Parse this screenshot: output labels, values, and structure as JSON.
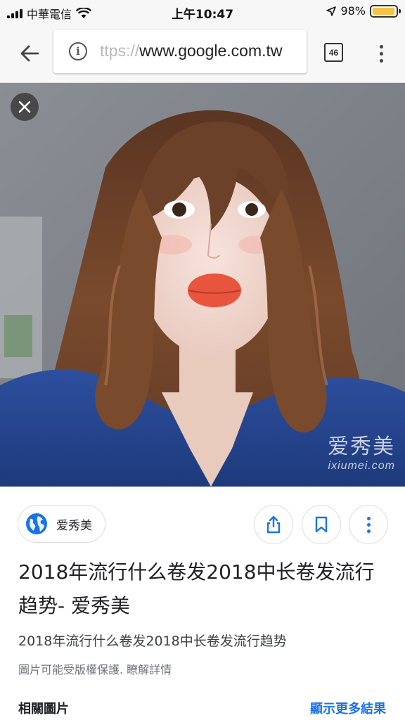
{
  "status_bar": {
    "carrier": "中華電信",
    "time": "上午10:47",
    "battery": "98%",
    "battery_level": 0.98
  },
  "browser": {
    "back_icon": "arrow-left-icon",
    "info_icon": "info-icon",
    "url_faded": "ttps://",
    "url_main": "www.google.com.tw",
    "tab_count": "46",
    "menu_icon": "more-vert-icon"
  },
  "image_viewer": {
    "close_icon": "close-icon",
    "watermark_title": "爱秀美",
    "watermark_domain": "ixiumei.com"
  },
  "result": {
    "source": "爱秀美",
    "share_icon": "share-icon",
    "save_icon": "bookmark-icon",
    "more_icon": "more-vert-icon",
    "title": "2018年流行什么卷发2018中长卷发流行趋势- 爱秀美",
    "snippet": "2018年流行什么卷发2018中长卷发流行趋势",
    "copyright_note": "圖片可能受版權保護. 瞭解詳情",
    "related_label": "相關圖片",
    "more_results_label": "顯示更多結果"
  },
  "colors": {
    "accent_blue": "#1a73e8",
    "battery_yellow": "#f6c343"
  }
}
